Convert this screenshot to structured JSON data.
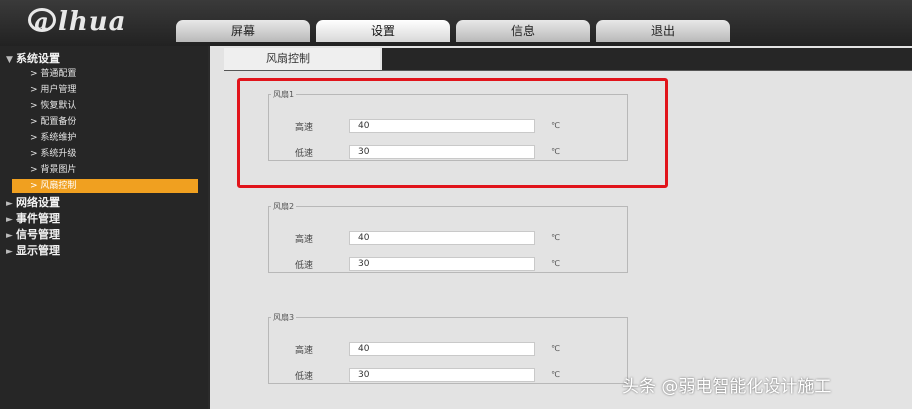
{
  "logo": {
    "text": "alhua"
  },
  "tabs": [
    {
      "label": "屏幕"
    },
    {
      "label": "设置"
    },
    {
      "label": "信息"
    },
    {
      "label": "退出"
    }
  ],
  "sidebar": {
    "groups": [
      {
        "label": "系统设置",
        "expanded": true,
        "items": [
          {
            "label": "> 普通配置"
          },
          {
            "label": "> 用户管理"
          },
          {
            "label": "> 恢复默认"
          },
          {
            "label": "> 配置备份"
          },
          {
            "label": "> 系统维护"
          },
          {
            "label": "> 系统升级"
          },
          {
            "label": "> 背景图片"
          },
          {
            "label": "> 风扇控制",
            "active": true
          }
        ]
      },
      {
        "label": "网络设置"
      },
      {
        "label": "事件管理"
      },
      {
        "label": "信号管理"
      },
      {
        "label": "显示管理"
      }
    ]
  },
  "content": {
    "tab": "风扇控制",
    "fans": [
      {
        "legend": "风扇1",
        "high_label": "高速",
        "high_value": "40",
        "low_label": "低速",
        "low_value": "30",
        "unit": "℃"
      },
      {
        "legend": "风扇2",
        "high_label": "高速",
        "high_value": "40",
        "low_label": "低速",
        "low_value": "30",
        "unit": "℃"
      },
      {
        "legend": "风扇3",
        "high_label": "高速",
        "high_value": "40",
        "low_label": "低速",
        "low_value": "30",
        "unit": "℃"
      }
    ]
  },
  "watermark": "头条 @弱电智能化设计施工",
  "colors": {
    "accent": "#f0a020",
    "highlight": "#e1141b"
  }
}
